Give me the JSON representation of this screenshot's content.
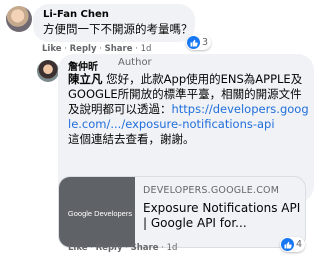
{
  "comment1": {
    "author": "Li-Fan Chen",
    "text": "方便問一下不開源的考量嗎？",
    "like_label": "Like",
    "reply_label": "Reply",
    "share_label": "Share",
    "time": "1d",
    "reaction_count": "3"
  },
  "comment2": {
    "author": "詹仲昕",
    "badge": "Author",
    "mention": "陳立凡",
    "text_before_link": " 您好，此款App使用的ENS為APPLE及GOOGLE所開放的標準平臺，相關的開源文件及說明都可以透過：",
    "link": "https://developers.google.com/.../exposure-notifications-api",
    "text_after_link": "這個連結去查看，謝謝。",
    "like_label": "Like",
    "reply_label": "Reply",
    "share_label": "Share",
    "time": "1d",
    "reaction_count": "4"
  },
  "preview": {
    "thumb_text": "Google Developers",
    "domain": "DEVELOPERS.GOOGLE.COM",
    "title": "Exposure Notifications API  |  Google API for..."
  },
  "colors": {
    "link": "#216fdb",
    "like_badge": "#1877f2",
    "bubble": "#f0f2f5"
  }
}
